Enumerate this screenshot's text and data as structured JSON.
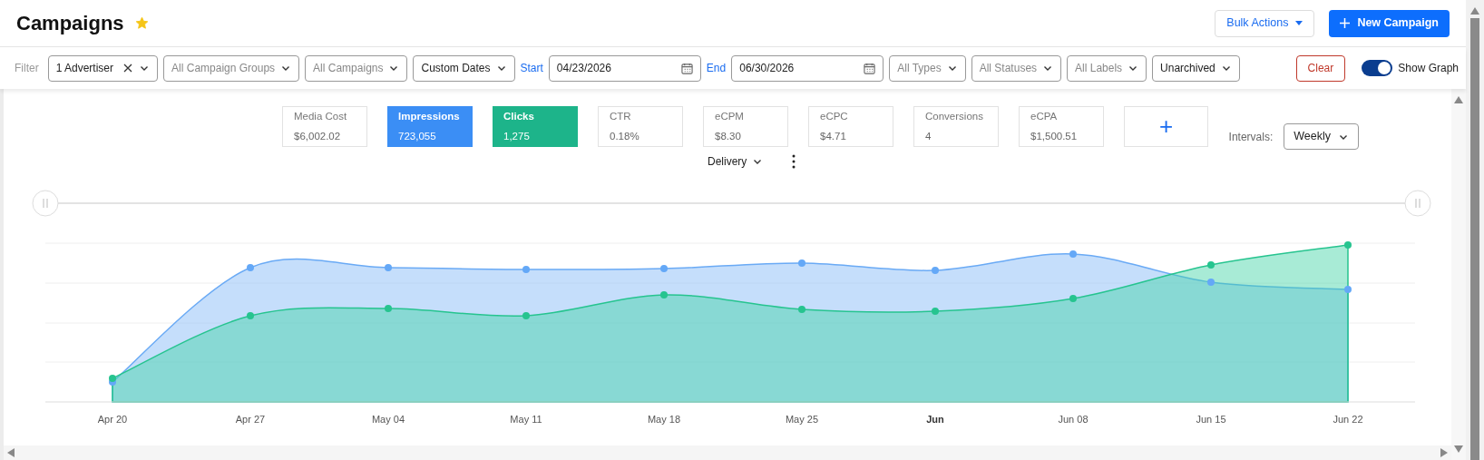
{
  "header": {
    "title": "Campaigns",
    "favorite": true,
    "bulk_actions": "Bulk Actions",
    "new_campaign": "New Campaign"
  },
  "filter_bar": {
    "label": "Filter",
    "filters": [
      {
        "kind": "dropdown",
        "value": "1 Advertiser",
        "clearable": true
      },
      {
        "kind": "dropdown",
        "placeholder": "All Campaign Groups",
        "clearable": false
      },
      {
        "kind": "dropdown",
        "placeholder": "All Campaigns",
        "clearable": false
      },
      {
        "kind": "dropdown",
        "value": "Custom Dates",
        "clearable": false
      },
      {
        "kind": "date",
        "label": "Start",
        "value": "04/23/2026"
      },
      {
        "kind": "date",
        "label": "End",
        "value": "06/30/2026"
      },
      {
        "kind": "dropdown",
        "placeholder": "All Types",
        "clearable": false
      },
      {
        "kind": "dropdown",
        "placeholder": "All Statuses",
        "clearable": false
      },
      {
        "kind": "dropdown",
        "placeholder": "All Labels",
        "clearable": false
      },
      {
        "kind": "dropdown",
        "value": "Unarchived",
        "clearable": false
      }
    ],
    "clear": "Clear",
    "show_graph": {
      "label": "Show Graph",
      "on": true
    }
  },
  "metrics": [
    {
      "kind": "metric",
      "label": "Media Cost",
      "value": "$6,002.02",
      "selected": false
    },
    {
      "kind": "metric",
      "label": "Impressions",
      "value": "723,055",
      "selected": true,
      "color": "#3b8ef5"
    },
    {
      "kind": "metric",
      "label": "Clicks",
      "value": "1,275",
      "selected": true,
      "color": "#1db48a"
    },
    {
      "kind": "metric",
      "label": "CTR",
      "value": "0.18%",
      "selected": false
    },
    {
      "kind": "metric",
      "label": "eCPM",
      "value": "$8.30",
      "selected": false
    },
    {
      "kind": "metric",
      "label": "eCPC",
      "value": "$4.71",
      "selected": false
    },
    {
      "kind": "metric",
      "label": "Conversions",
      "value": "4",
      "selected": false
    },
    {
      "kind": "metric",
      "label": "eCPA",
      "value": "$1,500.51",
      "selected": false
    },
    {
      "kind": "add",
      "label": "+"
    }
  ],
  "intervals": {
    "label": "Intervals:",
    "value": "Weekly"
  },
  "view": {
    "value": "Delivery"
  },
  "chart": {
    "x_labels": [
      {
        "text": "Apr 20",
        "bold": false
      },
      {
        "text": "Apr 27",
        "bold": false
      },
      {
        "text": "May 04",
        "bold": false
      },
      {
        "text": "May 11",
        "bold": false
      },
      {
        "text": "May 18",
        "bold": false
      },
      {
        "text": "May 25",
        "bold": false
      },
      {
        "text": "Jun",
        "bold": true
      },
      {
        "text": "Jun 08",
        "bold": false
      },
      {
        "text": "Jun 15",
        "bold": false
      },
      {
        "text": "Jun 22",
        "bold": false
      }
    ]
  }
}
